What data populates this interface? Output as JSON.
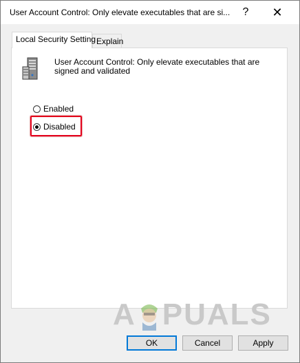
{
  "window": {
    "title": "User Account Control: Only elevate executables that are si...",
    "help_glyph": "?",
    "close_glyph": "✕"
  },
  "tabs": [
    {
      "label": "Local Security Setting",
      "active": true
    },
    {
      "label": "Explain",
      "active": false
    }
  ],
  "policy": {
    "icon": "server-policy-icon",
    "description": "User Account Control: Only elevate executables that are signed and validated"
  },
  "options": {
    "enabled_label": "Enabled",
    "disabled_label": "Disabled",
    "selected": "Disabled"
  },
  "watermark": {
    "left_text": "A",
    "right_text": "PUALS"
  },
  "buttons": {
    "ok": "OK",
    "cancel": "Cancel",
    "apply": "Apply"
  },
  "colors": {
    "highlight": "#e3001b",
    "focus": "#0078d7"
  }
}
